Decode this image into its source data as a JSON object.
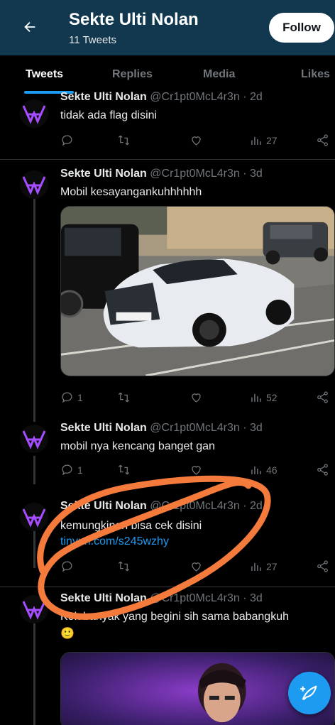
{
  "header": {
    "name": "Sekte Ulti Nolan",
    "tweet_count": "11 Tweets",
    "follow_label": "Follow"
  },
  "tabs": [
    {
      "label": "Tweets",
      "active": true
    },
    {
      "label": "Replies",
      "active": false
    },
    {
      "label": "Media",
      "active": false
    },
    {
      "label": "Likes",
      "active": false
    }
  ],
  "tweets": [
    {
      "name": "Sekte Ulti Nolan",
      "handle_time": "@Cr1pt0McL4r3n · 2d",
      "text": "tidak ada flag disini",
      "replies": "",
      "views": "27"
    },
    {
      "name": "Sekte Ulti Nolan",
      "handle_time": "@Cr1pt0McL4r3n · 3d",
      "text": "Mobil kesayangankuhhhhhh",
      "replies": "1",
      "views": "52"
    },
    {
      "name": "Sekte Ulti Nolan",
      "handle_time": "@Cr1pt0McL4r3n · 3d",
      "text": "mobil nya kencang banget gan",
      "replies": "1",
      "views": "46"
    },
    {
      "name": "Sekte Ulti Nolan",
      "handle_time": "@Cr1pt0McL4r3n · 2d",
      "text": "kemungkinan bisa cek disini",
      "link": "tinyurl.com/s245wzhy",
      "replies": "",
      "views": "27"
    },
    {
      "name": "Sekte Ulti Nolan",
      "handle_time": "@Cr1pt0McL4r3n · 3d",
      "text": "Kok banyak yang begini sih sama babangkuh",
      "emoji": "🙂"
    }
  ],
  "colors": {
    "header_bg": "#12384f",
    "accent": "#1d9bf0",
    "avatar_logo": "#a64dff",
    "scribble": "#f47b3b"
  },
  "icons": [
    "back-arrow-icon",
    "reply-icon",
    "retweet-icon",
    "like-icon",
    "views-icon",
    "share-icon",
    "compose-icon"
  ]
}
